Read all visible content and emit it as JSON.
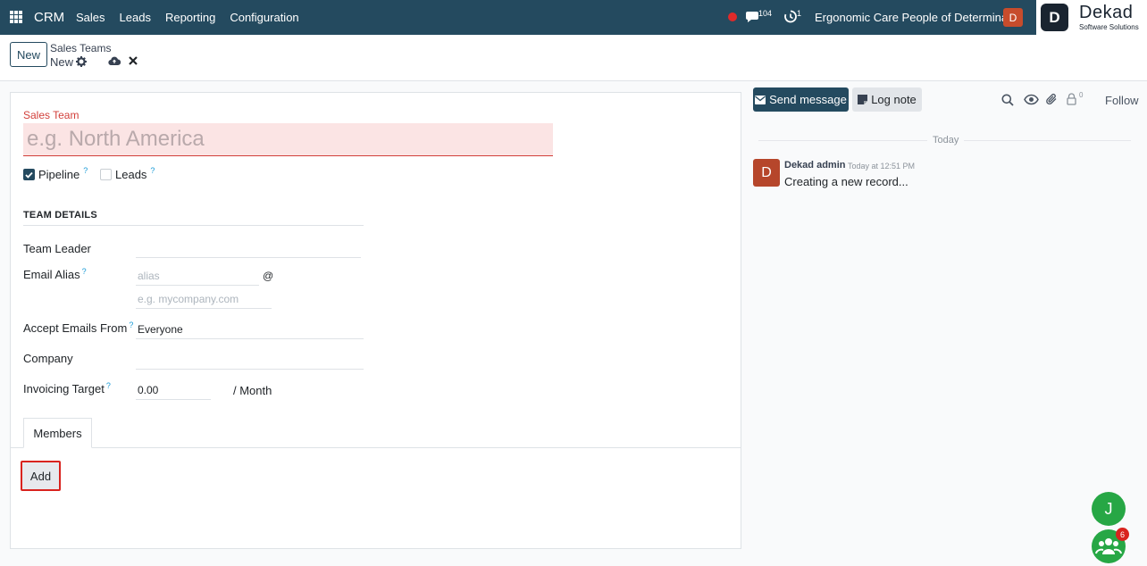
{
  "navbar": {
    "brand": "CRM",
    "menu": [
      "Sales",
      "Leads",
      "Reporting",
      "Configuration"
    ],
    "chat_count": "104",
    "activity_count": "1",
    "company": "Ergonomic Care People of Determina...",
    "user_initial": "D",
    "logo": {
      "mark": "D",
      "title": "Dekad",
      "subtitle": "Software Solutions"
    }
  },
  "control": {
    "new_label": "New",
    "breadcrumb_parent": "Sales Teams",
    "breadcrumb_current": "New"
  },
  "form": {
    "team_label": "Sales Team",
    "team_placeholder": "e.g. North America",
    "pipeline_label": "Pipeline",
    "pipeline_checked": true,
    "leads_label": "Leads",
    "leads_checked": false,
    "help_mark": "?",
    "section_title": "TEAM DETAILS",
    "team_leader_label": "Team Leader",
    "team_leader_value": "",
    "email_alias_label": "Email Alias",
    "alias_placeholder": "alias",
    "at_sign": "@",
    "domain_placeholder": "e.g. mycompany.com",
    "accept_label": "Accept Emails From",
    "accept_value": "Everyone",
    "company_label": "Company",
    "company_value": "",
    "invoicing_label": "Invoicing Target",
    "invoicing_value": "0.00",
    "per_month": "/ Month",
    "tab_members": "Members",
    "add_label": "Add"
  },
  "chatter": {
    "send_label": "Send message",
    "log_label": "Log note",
    "follower_count": "0",
    "follow_label": "Follow",
    "date_separator": "Today",
    "message": {
      "avatar": "D",
      "author": "Dekad admin",
      "time": "Today at 12:51 PM",
      "body": "Creating a new record..."
    }
  },
  "floating": {
    "user_initial": "J",
    "group_badge": "6"
  },
  "colors": {
    "navbar": "#244a5f",
    "required": "#d23f3a",
    "accent_green": "#27a745",
    "highlight_red": "#d9231e"
  }
}
